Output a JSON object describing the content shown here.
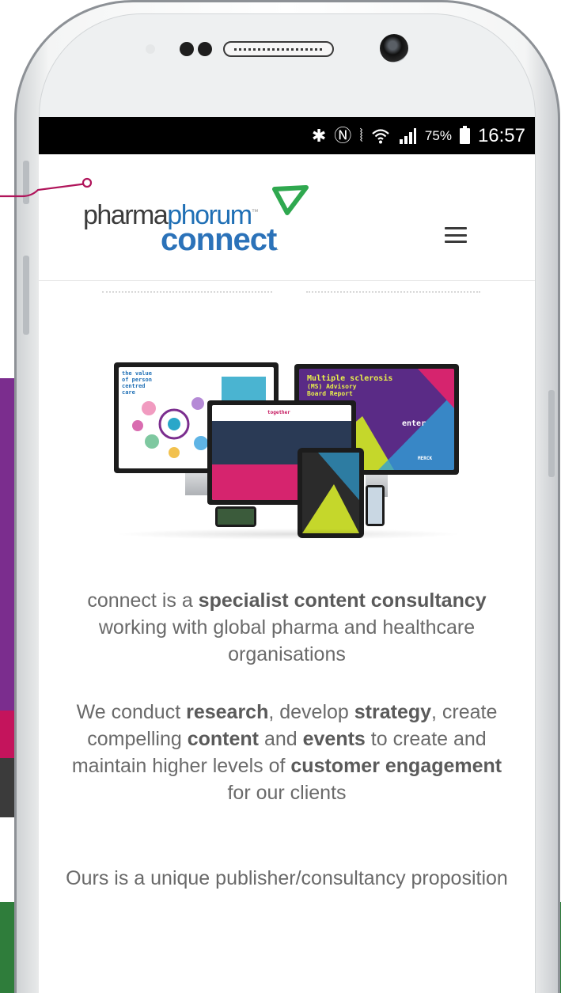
{
  "status_bar": {
    "bluetooth_icon": "bluetooth-icon",
    "nfc_icon": "nfc-icon",
    "mute_icon": "vibrate-icon",
    "wifi_icon": "wifi-icon",
    "signal_icon": "signal-icon",
    "battery_percent": "75%",
    "time": "16:57"
  },
  "header": {
    "logo_part1": "pharma",
    "logo_part2": "phorum",
    "logo_tm": "™",
    "logo_line2": "connect",
    "logo_tm2": ".",
    "menu_icon": "hamburger-icon"
  },
  "hero": {
    "left_screen_text": "the value of person centred care",
    "right_screen_text_1": "Multiple sclerosis",
    "right_screen_text_2": "(MS) Advisory",
    "right_screen_text_3": "Board Report",
    "right_screen_enter": "enter",
    "right_screen_brand": "MERCK",
    "center_screen_title": "together"
  },
  "copy": {
    "p1_a": "connect is a ",
    "p1_b": "specialist content consultancy",
    "p1_c": " working with global pharma and healthcare organisations",
    "p2_a": "We conduct ",
    "p2_b": "research",
    "p2_c": ", develop ",
    "p2_d": "strategy",
    "p2_e": ", create compelling ",
    "p2_f": "content",
    "p2_g": " and ",
    "p2_h": "events",
    "p2_i": " to create and maintain higher levels of ",
    "p2_j": "customer engagement",
    "p2_k": " for our clients",
    "p3": "Ours is a unique publisher/consultancy proposition"
  },
  "colors": {
    "brand_blue": "#2b72b9",
    "logo_leaf_green": "#2fa84f",
    "callout": "#b0145a",
    "bg_purple": "#7b2d8e",
    "bg_pink": "#c4145c",
    "bg_green": "#2f7d3b"
  }
}
